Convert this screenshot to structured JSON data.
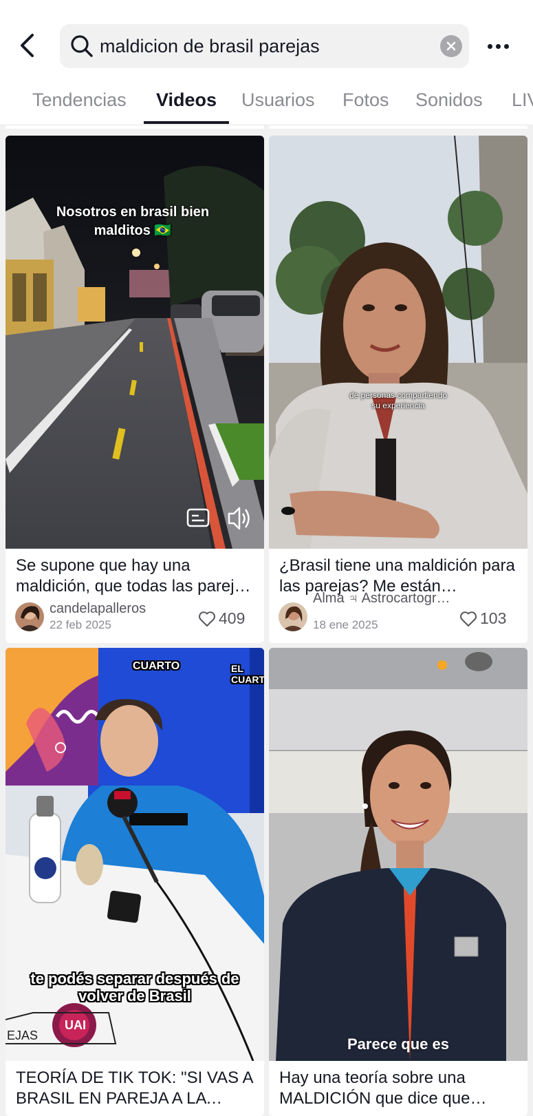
{
  "search": {
    "query": "maldicion de brasil parejas"
  },
  "tabs": [
    {
      "label": "Tendencias",
      "active": false
    },
    {
      "label": "Videos",
      "active": true
    },
    {
      "label": "Usuarios",
      "active": false
    },
    {
      "label": "Fotos",
      "active": false
    },
    {
      "label": "Sonidos",
      "active": false
    },
    {
      "label": "LIVE",
      "active": false
    }
  ],
  "videos": [
    {
      "overlay_text": "Nosotros en brasil bien malditos 🇧🇷",
      "caption": "Se supone que hay una maldición, que todas las parejas que van a Brasil terminan",
      "author": "candelapalleros",
      "date": "22 feb 2025",
      "likes": "409"
    },
    {
      "overlay_text": "de personas compartiendo su experiencia",
      "caption": "¿Brasil tiene una maldición para las parejas? Me están escribiendo",
      "author": "Alma ♃ Astrocartografía",
      "date": "18 ene 2025",
      "likes": "103"
    },
    {
      "overlay_text": "te podés separar después de volver de Brasil",
      "corner_text": "EJAS",
      "logo_text": "UAI",
      "studio_text": "CUARTO",
      "studio_text_2": "EL CUARTO",
      "caption": "TEORÍA DE TIK TOK: \"SI VAS A BRASIL EN PAREJA A LA VUELTA TE SEPARÁS\""
    },
    {
      "overlay_text": "Parece que es",
      "caption": "Hay una teoría sobre una MALDICIÓN que dice que muchas parejas"
    }
  ],
  "colors": {
    "like": "#55565c",
    "accent_underline": "#161823",
    "background": "#f1f1f2"
  }
}
